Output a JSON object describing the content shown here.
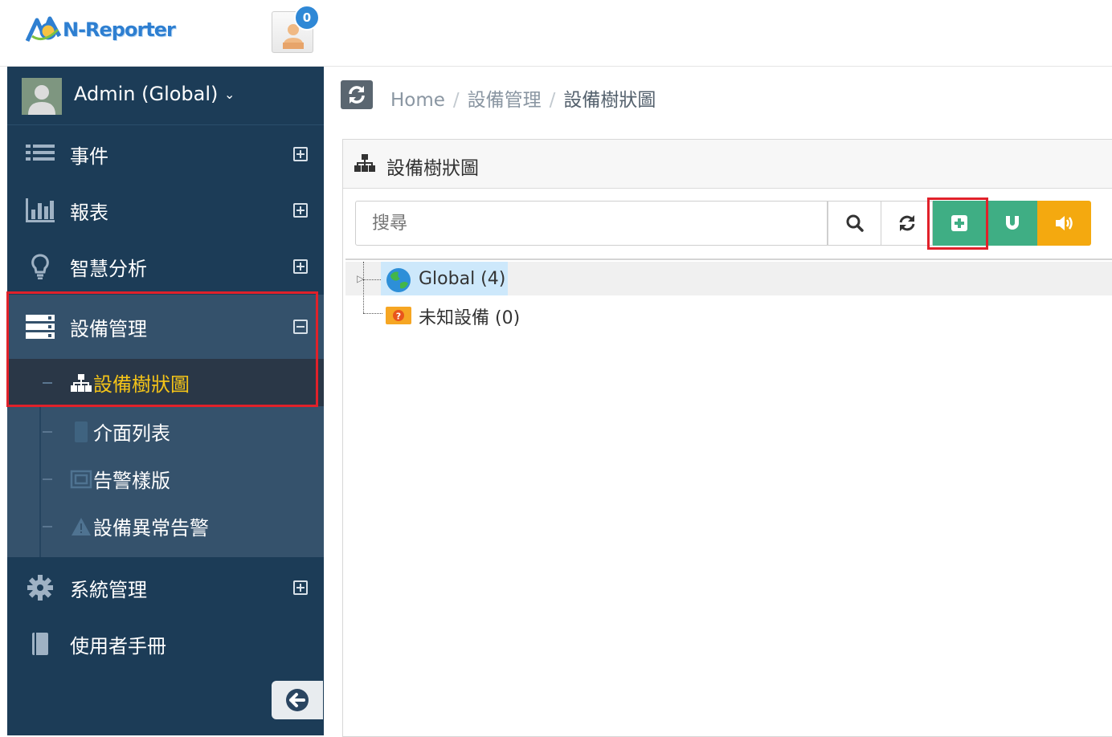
{
  "app": {
    "logo_text": "N-Reporter",
    "notification_count": "0"
  },
  "sidebar": {
    "user_label": "Admin (Global)",
    "items": [
      {
        "label": "事件",
        "icon": "list-icon"
      },
      {
        "label": "報表",
        "icon": "bar-chart-icon"
      },
      {
        "label": "智慧分析",
        "icon": "lightbulb-icon"
      },
      {
        "label": "設備管理",
        "icon": "server-icon",
        "expanded": true
      },
      {
        "label": "系統管理",
        "icon": "gear-icon"
      },
      {
        "label": "使用者手冊",
        "icon": "book-icon"
      }
    ],
    "subitems": [
      {
        "label": "設備樹狀圖",
        "icon": "sitemap-icon",
        "active": true
      },
      {
        "label": "介面列表",
        "icon": "interface-icon"
      },
      {
        "label": "告警樣版",
        "icon": "template-icon"
      },
      {
        "label": "設備異常告警",
        "icon": "warning-icon"
      }
    ]
  },
  "breadcrumb": {
    "home": "Home",
    "sep": "/",
    "level1": "設備管理",
    "current": "設備樹狀圖"
  },
  "panel": {
    "title": "設備樹狀圖",
    "search_placeholder": "搜尋"
  },
  "tree": {
    "nodes": [
      {
        "label": "Global (4)",
        "icon": "globe-icon",
        "selected": true
      },
      {
        "label": "未知設備 (0)",
        "icon": "unknown-device-icon"
      }
    ]
  },
  "colors": {
    "sidebar_bg": "#1c3c57",
    "submenu_bg": "#35526c",
    "active_text": "#f3c318",
    "green_button": "#3fae84",
    "orange_button": "#f4a90f",
    "highlight": "#e0212a"
  }
}
